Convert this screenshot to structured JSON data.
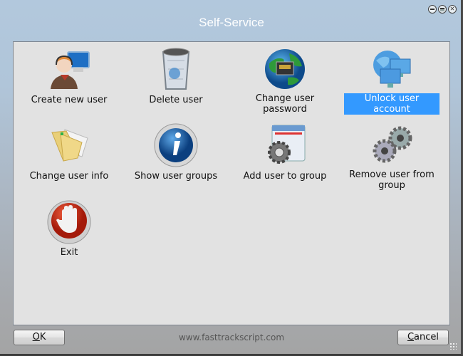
{
  "window": {
    "title": "Self-Service"
  },
  "window_controls": {
    "minimize": "minimize-icon",
    "maximize": "maximize-icon",
    "close": "close-icon"
  },
  "actions": [
    {
      "label": "Create new user",
      "icon": "user-headset-computer-icon",
      "selected": false
    },
    {
      "label": "Delete user",
      "icon": "recycle-bin-icon",
      "selected": false
    },
    {
      "label": "Change user password",
      "icon": "globe-network-port-icon",
      "selected": false
    },
    {
      "label": "Unlock user account",
      "icon": "network-computers-icon",
      "selected": true
    },
    {
      "label": "Change user info",
      "icon": "folder-icon",
      "selected": false
    },
    {
      "label": "Show user groups",
      "icon": "info-icon",
      "selected": false
    },
    {
      "label": "Add user to group",
      "icon": "window-gear-icon",
      "selected": false
    },
    {
      "label": "Remove user from group",
      "icon": "gears-icon",
      "selected": false
    },
    {
      "label": "Exit",
      "icon": "stop-hand-icon",
      "selected": false
    }
  ],
  "footer": {
    "ok_label": "OK",
    "ok_mnemonic": "O",
    "cancel_label": "Cancel",
    "cancel_mnemonic": "C",
    "website": "www.fasttrackscript.com"
  },
  "colors": {
    "selection": "#3399ff",
    "panel": "#e2e2e2"
  }
}
